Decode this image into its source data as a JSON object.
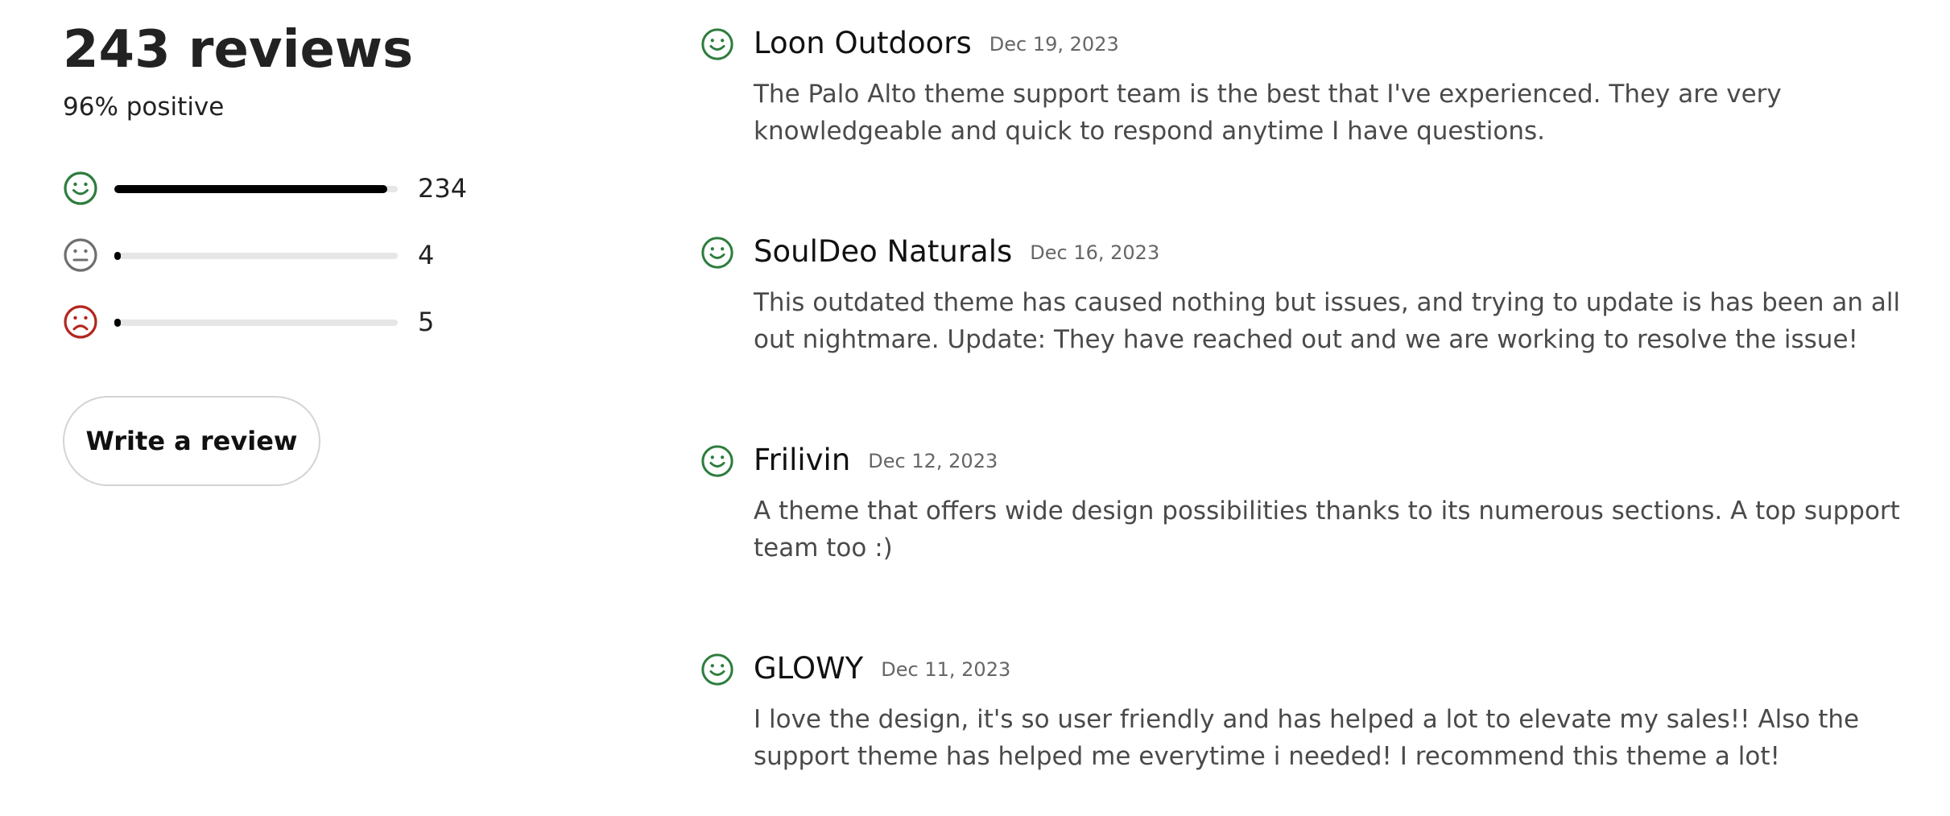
{
  "summary": {
    "title": "243 reviews",
    "subtitle": "96% positive",
    "ratings": [
      {
        "icon": "smile-face-icon",
        "color": "#2e7d3e",
        "count": "234",
        "fraction": 0.963
      },
      {
        "icon": "neutral-face-icon",
        "color": "#6f6f6f",
        "count": "4",
        "fraction": 0.016
      },
      {
        "icon": "sad-face-icon",
        "color": "#b3261e",
        "count": "5",
        "fraction": 0.021
      }
    ],
    "write_review_label": "Write a review"
  },
  "reviews": [
    {
      "author": "Loon Outdoors",
      "date": "Dec 19, 2023",
      "sentiment": "positive",
      "body": "The Palo Alto theme support team is the best that I've experienced. They are very knowledgeable and quick to respond anytime I have questions."
    },
    {
      "author": "SoulDeo Naturals",
      "date": "Dec 16, 2023",
      "sentiment": "positive",
      "body": "This outdated theme has caused nothing but issues, and trying to update is has been an all out nightmare. Update: They have reached out and we are working to resolve the issue!"
    },
    {
      "author": "Frilivin",
      "date": "Dec 12, 2023",
      "sentiment": "positive",
      "body": "A theme that offers wide design possibilities thanks to its numerous sections. A top support team too :)"
    },
    {
      "author": "GLOWY",
      "date": "Dec 11, 2023",
      "sentiment": "positive",
      "body": "I love the design, it's so user friendly and has helped a lot to elevate my sales!! Also the support theme has helped me everytime i needed! I recommend this theme a lot!"
    }
  ],
  "colors": {
    "positive": "#2e7d3e",
    "neutral": "#6f6f6f",
    "negative": "#b3261e",
    "bar_fill": "#000000",
    "bar_track": "#e6e6e6"
  }
}
